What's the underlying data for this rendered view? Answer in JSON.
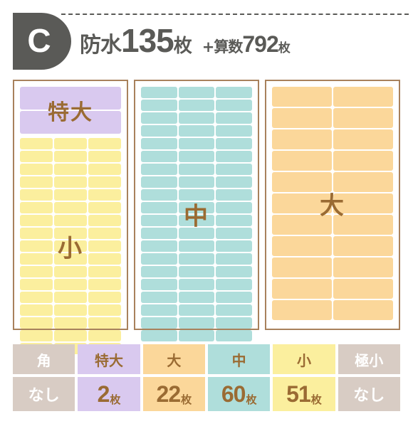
{
  "header": {
    "badge_letter": "C",
    "waterproof_label": "防水",
    "waterproof_count": "135",
    "waterproof_unit": "枚",
    "plus_sign": "+",
    "math_label": "算数",
    "math_count": "792",
    "math_unit": "枚"
  },
  "panels": [
    {
      "name": "panel-small-and-extra-large",
      "groups": [
        {
          "label": "特大",
          "color": "#d9c9ef",
          "columns": 1,
          "rows": 2,
          "count": 2,
          "cell_style": "wide"
        },
        {
          "label": "小",
          "color": "#fbef9e",
          "columns": 3,
          "rows": 17,
          "count": 51,
          "cell_style": "normal"
        }
      ]
    },
    {
      "name": "panel-medium",
      "groups": [
        {
          "label": "中",
          "color": "#afdedb",
          "columns": 3,
          "rows": 20,
          "count": 60,
          "cell_style": "normal"
        }
      ]
    },
    {
      "name": "panel-large",
      "groups": [
        {
          "label": "大",
          "color": "#fbd79a",
          "columns": 2,
          "rows": 11,
          "count": 22,
          "cell_style": "tall"
        }
      ]
    }
  ],
  "legend": {
    "columns": [
      {
        "label": "角",
        "value": "なし",
        "count": null,
        "unit": "",
        "bg": "#d8ccc4",
        "head_fg": "#ffffff",
        "val_fg": "#ffffff"
      },
      {
        "label": "特大",
        "value": "2",
        "count": 2,
        "unit": "枚",
        "bg": "#d9c9ef",
        "head_fg": "#9a6b33",
        "val_fg": "#9a6b33"
      },
      {
        "label": "大",
        "value": "22",
        "count": 22,
        "unit": "枚",
        "bg": "#fbd79a",
        "head_fg": "#9a6b33",
        "val_fg": "#9a6b33"
      },
      {
        "label": "中",
        "value": "60",
        "count": 60,
        "unit": "枚",
        "bg": "#afdedb",
        "head_fg": "#9a6b33",
        "val_fg": "#9a6b33"
      },
      {
        "label": "小",
        "value": "51",
        "count": 51,
        "unit": "枚",
        "bg": "#fbef9e",
        "head_fg": "#9a6b33",
        "val_fg": "#9a6b33"
      },
      {
        "label": "極小",
        "value": "なし",
        "count": null,
        "unit": "",
        "bg": "#d8ccc4",
        "head_fg": "#ffffff",
        "val_fg": "#ffffff"
      }
    ]
  },
  "colors": {
    "badge_bg": "#5a5a57",
    "title_fg": "#5a5a57",
    "panel_border": "#a8815c",
    "label_fg": "#9a6b33",
    "purple": "#d9c9ef",
    "yellow": "#fbef9e",
    "teal": "#afdedb",
    "orange": "#fbd79a",
    "gray": "#d8ccc4"
  }
}
